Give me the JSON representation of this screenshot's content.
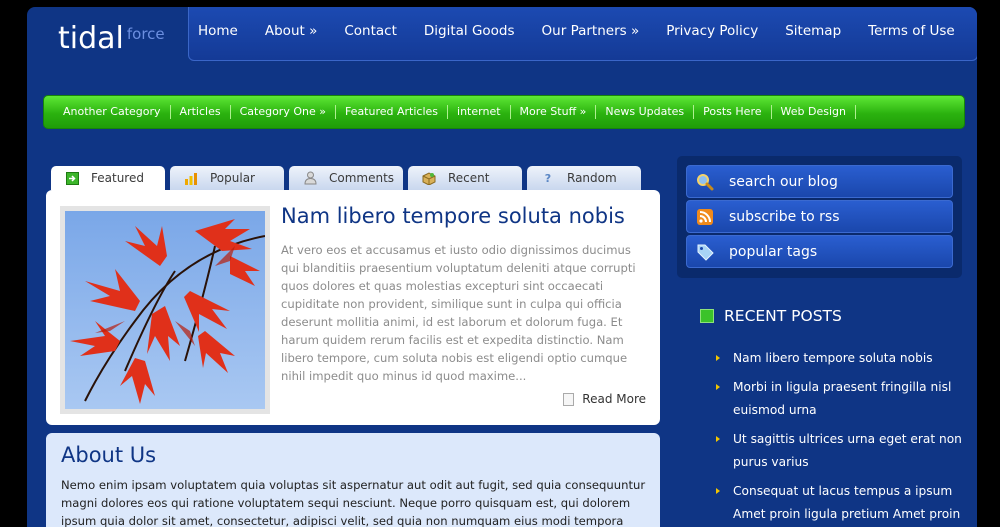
{
  "logo": {
    "main": "tidal",
    "sub": "force"
  },
  "topnav": [
    "Home",
    "About »",
    "Contact",
    "Digital Goods",
    "Our Partners »",
    "Privacy Policy",
    "Sitemap",
    "Terms of Use"
  ],
  "categories": [
    "Another Category",
    "Articles",
    "Category One »",
    "Featured Articles",
    "internet",
    "More Stuff »",
    "News Updates",
    "Posts Here",
    "Web Design"
  ],
  "tabs": [
    {
      "label": "Featured",
      "icon": "arrow-box-icon",
      "active": true
    },
    {
      "label": "Popular",
      "icon": "bar-chart-icon"
    },
    {
      "label": "Comments",
      "icon": "user-icon"
    },
    {
      "label": "Recent",
      "icon": "box-icon"
    },
    {
      "label": "Random",
      "icon": "question-icon"
    }
  ],
  "featured": {
    "title": "Nam libero tempore soluta nobis",
    "text": "At vero eos et accusamus et iusto odio dignissimos ducimus qui blanditiis praesentium voluptatum deleniti atque corrupti quos dolores et quas molestias excepturi sint occaecati cupiditate non provident, similique sunt in culpa qui officia deserunt mollitia animi, id est laborum et dolorum fuga. Et harum quidem rerum facilis est et expedita distinctio. Nam libero tempore, cum soluta nobis est eligendi optio cumque nihil impedit quo minus id quod maxime...",
    "read_more": "Read More"
  },
  "about": {
    "title": "About Us",
    "text": "Nemo enim ipsam voluptatem quia voluptas sit aspernatur aut odit aut fugit, sed quia consequuntur magni dolores eos qui ratione voluptatem sequi nesciunt. Neque porro quisquam est, qui dolorem ipsum quia dolor sit amet, consectetur, adipisci velit, sed quia non numquam eius modi tempora incidunt."
  },
  "sidebar": {
    "buttons": [
      {
        "label": "search our blog",
        "icon": "magnifier-icon"
      },
      {
        "label": "subscribe to rss",
        "icon": "rss-icon"
      },
      {
        "label": "popular tags",
        "icon": "tag-icon"
      }
    ],
    "recent_title": "RECENT POSTS",
    "recent_posts": [
      "Nam libero tempore soluta nobis",
      "Morbi in ligula praesent fringilla nisl euismod urna",
      "Ut sagittis ultrices urna eget erat non purus varius",
      "Consequat ut lacus tempus a ipsum Amet proin ligula pretium Amet proin"
    ]
  },
  "colors": {
    "background": "#0f3585",
    "nav_green": "#2bb20f",
    "title_blue": "#0f3585",
    "bullet": "#f2c500"
  }
}
